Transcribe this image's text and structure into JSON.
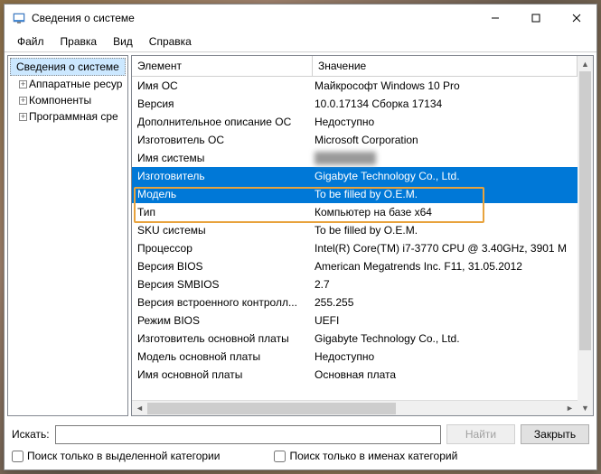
{
  "window": {
    "title": "Сведения о системе"
  },
  "menu": {
    "file": "Файл",
    "edit": "Правка",
    "view": "Вид",
    "help": "Справка"
  },
  "tree": {
    "root": "Сведения о системе",
    "items": [
      "Аппаратные ресур",
      "Компоненты",
      "Программная сре"
    ]
  },
  "columns": {
    "element": "Элемент",
    "value": "Значение"
  },
  "rows": [
    {
      "k": "Имя ОС",
      "v": "Майкрософт Windows 10 Pro",
      "sel": false
    },
    {
      "k": "Версия",
      "v": "10.0.17134 Сборка 17134",
      "sel": false
    },
    {
      "k": "Дополнительное описание ОС",
      "v": "Недоступно",
      "sel": false
    },
    {
      "k": "Изготовитель ОС",
      "v": "Microsoft Corporation",
      "sel": false
    },
    {
      "k": "Имя системы",
      "v": "████████",
      "sel": false,
      "obscured": true
    },
    {
      "k": "Изготовитель",
      "v": "Gigabyte Technology Co., Ltd.",
      "sel": true
    },
    {
      "k": "Модель",
      "v": "To be filled by O.E.M.",
      "sel": true
    },
    {
      "k": "Тип",
      "v": "Компьютер на базе x64",
      "sel": false
    },
    {
      "k": "SKU системы",
      "v": "To be filled by O.E.M.",
      "sel": false
    },
    {
      "k": "Процессор",
      "v": "Intel(R) Core(TM) i7-3770 CPU @ 3.40GHz, 3901 М",
      "sel": false
    },
    {
      "k": "Версия BIOS",
      "v": "American Megatrends Inc. F11, 31.05.2012",
      "sel": false
    },
    {
      "k": "Версия SMBIOS",
      "v": "2.7",
      "sel": false
    },
    {
      "k": "Версия встроенного контролл...",
      "v": "255.255",
      "sel": false
    },
    {
      "k": "Режим BIOS",
      "v": "UEFI",
      "sel": false
    },
    {
      "k": "Изготовитель основной платы",
      "v": "Gigabyte Technology Co., Ltd.",
      "sel": false
    },
    {
      "k": "Модель основной платы",
      "v": "Недоступно",
      "sel": false
    },
    {
      "k": "Имя основной платы",
      "v": "Основная плата",
      "sel": false
    }
  ],
  "search": {
    "label": "Искать:",
    "find": "Найти",
    "close": "Закрыть",
    "check1": "Поиск только в выделенной категории",
    "check2": "Поиск только в именах категорий"
  }
}
